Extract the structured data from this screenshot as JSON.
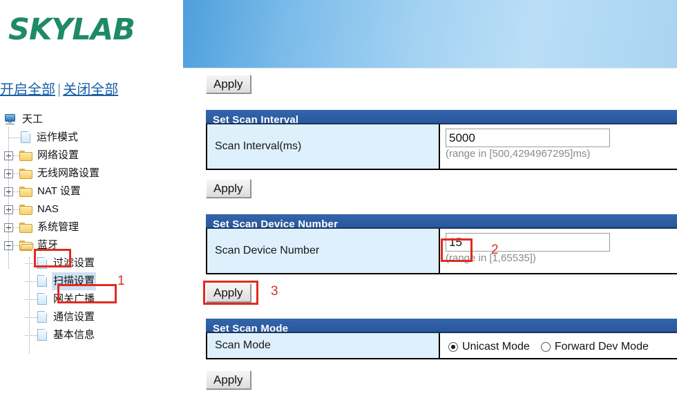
{
  "brand": {
    "logo_text": "SKYLAB"
  },
  "sidebar": {
    "expand_all_label": "开启全部",
    "separator": "|",
    "collapse_all_label": "关闭全部",
    "tree": {
      "root_label": "天工",
      "items": [
        {
          "label": "运作模式",
          "icon": "page-icon",
          "expander": "none",
          "level": 1
        },
        {
          "label": "网络设置",
          "icon": "folder-icon",
          "expander": "plus",
          "level": 1
        },
        {
          "label": "无线网路设置",
          "icon": "folder-icon",
          "expander": "plus",
          "level": 1
        },
        {
          "label": "NAT 设置",
          "icon": "folder-icon",
          "expander": "plus",
          "level": 1
        },
        {
          "label": "NAS",
          "icon": "folder-icon",
          "expander": "plus",
          "level": 1
        },
        {
          "label": "系统管理",
          "icon": "folder-icon",
          "expander": "plus",
          "level": 1
        },
        {
          "label": "蓝牙",
          "icon": "folder-open-icon",
          "expander": "minus",
          "level": 1
        },
        {
          "label": "过滤设置",
          "icon": "page-icon",
          "expander": "none",
          "level": 2
        },
        {
          "label": "扫描设置",
          "icon": "page-icon",
          "expander": "none",
          "level": 2
        },
        {
          "label": "网关广播",
          "icon": "page-icon",
          "expander": "none",
          "level": 2
        },
        {
          "label": "通信设置",
          "icon": "page-icon",
          "expander": "none",
          "level": 2
        },
        {
          "label": "基本信息",
          "icon": "page-icon",
          "expander": "none",
          "level": 2
        }
      ]
    }
  },
  "main": {
    "top_apply_label": "Apply",
    "sections": [
      {
        "title": "Set Scan Interval",
        "field_label": "Scan Interval(ms)",
        "value": "5000",
        "hint": "(range in [500,4294967295]ms)",
        "apply_label": "Apply"
      },
      {
        "title": "Set Scan Device Number",
        "field_label": "Scan Device Number",
        "value": "15",
        "hint": "(range in [1,65535])",
        "apply_label": "Apply"
      },
      {
        "title": "Set Scan Mode",
        "field_label": "Scan Mode",
        "options": [
          {
            "label": "Unicast Mode",
            "selected": true
          },
          {
            "label": "Forward Dev Mode",
            "selected": false
          }
        ],
        "apply_label": "Apply"
      }
    ]
  },
  "annotations": [
    {
      "number": "1",
      "target": "scan-settings-tree-item"
    },
    {
      "number": "2",
      "target": "scan-device-number-input"
    },
    {
      "number": "3",
      "target": "scan-device-number-apply-button"
    }
  ],
  "colors": {
    "brand_green": "#1e8a68",
    "section_header_blue": "#2c5ca8",
    "label_cell_blue": "#ddf0fb",
    "annotation_red": "#e02b22",
    "link_blue": "#1b5fa8",
    "selection_blue": "#cfe0f3"
  }
}
